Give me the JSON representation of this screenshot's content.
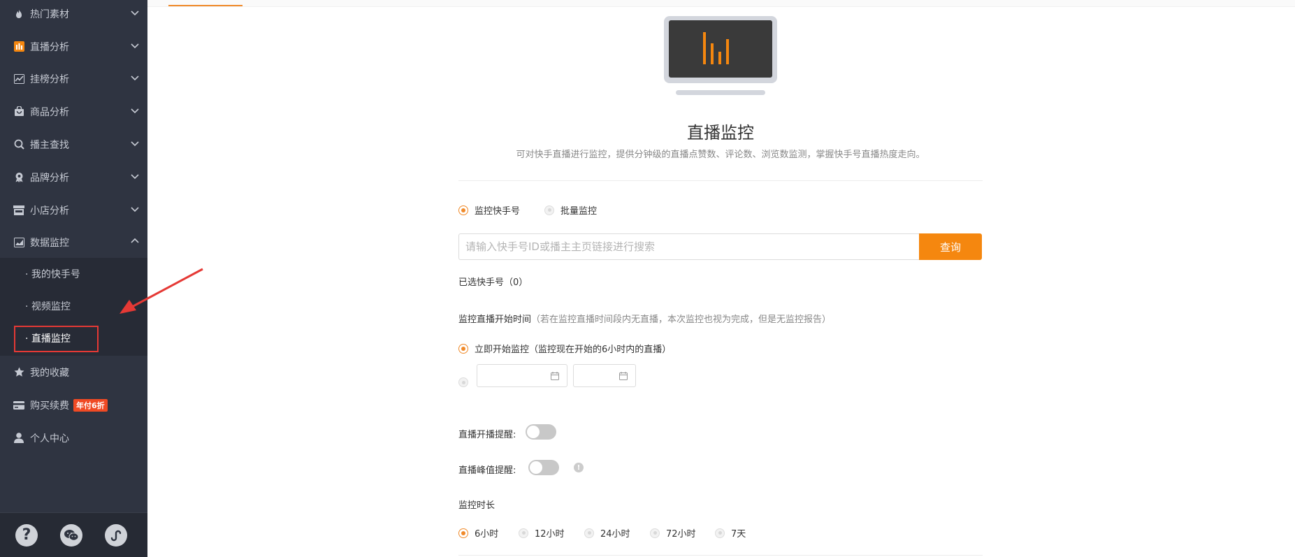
{
  "sidebar": {
    "items": [
      {
        "label": "热门素材",
        "icon": "flame-icon"
      },
      {
        "label": "直播分析",
        "icon": "bar-chart-icon"
      },
      {
        "label": "挂榜分析",
        "icon": "trend-icon"
      },
      {
        "label": "商品分析",
        "icon": "bag-icon"
      },
      {
        "label": "播主查找",
        "icon": "search-icon"
      },
      {
        "label": "品牌分析",
        "icon": "award-icon"
      },
      {
        "label": "小店分析",
        "icon": "store-icon"
      },
      {
        "label": "数据监控",
        "icon": "monitor-chart-icon"
      }
    ],
    "submenu": [
      {
        "label": "· 我的快手号"
      },
      {
        "label": "· 视频监控"
      },
      {
        "label": "· 直播监控"
      }
    ],
    "bottom_items": [
      {
        "label": "我的收藏",
        "icon": "star-icon"
      },
      {
        "label": "购买续费",
        "icon": "card-icon",
        "badge": "年付6折"
      },
      {
        "label": "个人中心",
        "icon": "user-icon"
      }
    ],
    "footer": {
      "icons": [
        "help-icon",
        "wechat-icon",
        "mini-program-icon"
      ]
    }
  },
  "main": {
    "title": "直播监控",
    "description": "可对快手直播进行监控，提供分钟级的直播点赞数、评论数、浏览数监测，掌握快手号直播热度走向。",
    "mode_options": [
      {
        "label": "监控快手号",
        "selected": true
      },
      {
        "label": "批量监控",
        "selected": false
      }
    ],
    "search": {
      "placeholder": "请输入快手号ID或播主主页链接进行搜索",
      "value": "",
      "button": "查询"
    },
    "selected_count_label": "已选快手号（0）",
    "start_time": {
      "label": "监控直播开始时间",
      "note": "（若在监控直播时间段内无直播，本次监控也视为完成，但是无监控报告）",
      "immediate_label": "立即开始监控（监控现在开始的6小时内的直播）"
    },
    "live_start_alert_label": "直播开播提醒:",
    "live_peak_alert_label": "直播峰值提醒:",
    "duration": {
      "label": "监控时长",
      "options": [
        "6小时",
        "12小时",
        "24小时",
        "72小时",
        "7天"
      ],
      "selected": 0
    }
  },
  "colors": {
    "accent": "#f5870f",
    "sidebar_bg": "#2f3441",
    "annotation_red": "#e53935"
  }
}
